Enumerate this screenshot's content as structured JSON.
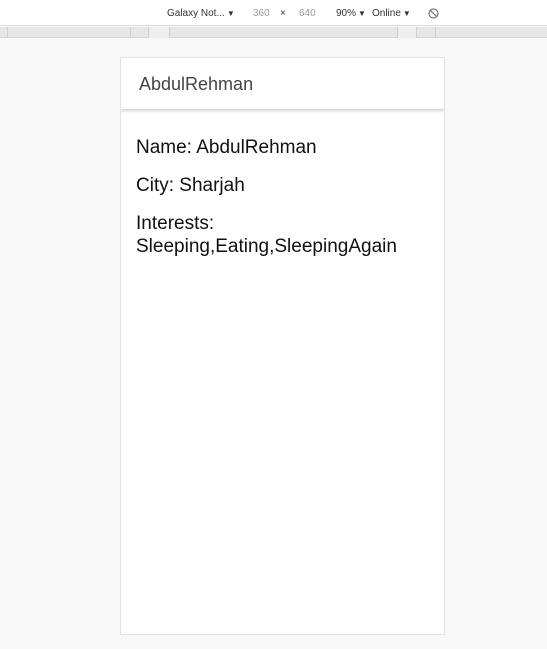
{
  "toolbar": {
    "device": "Galaxy Not...",
    "width": "360",
    "times": "×",
    "height": "640",
    "zoom": "90%",
    "network": "Online",
    "dropdown_icon": "triangle-down",
    "rotate_icon": "rotate-icon"
  },
  "app": {
    "title": "AbdulRehman"
  },
  "profile": {
    "name_label": "Name:",
    "name_value": "AbdulRehman",
    "city_label": "City:",
    "city_value": "Sharjah",
    "interests_label": "Interests:",
    "interests_value": "Sleeping,Eating,SleepingAgain"
  }
}
